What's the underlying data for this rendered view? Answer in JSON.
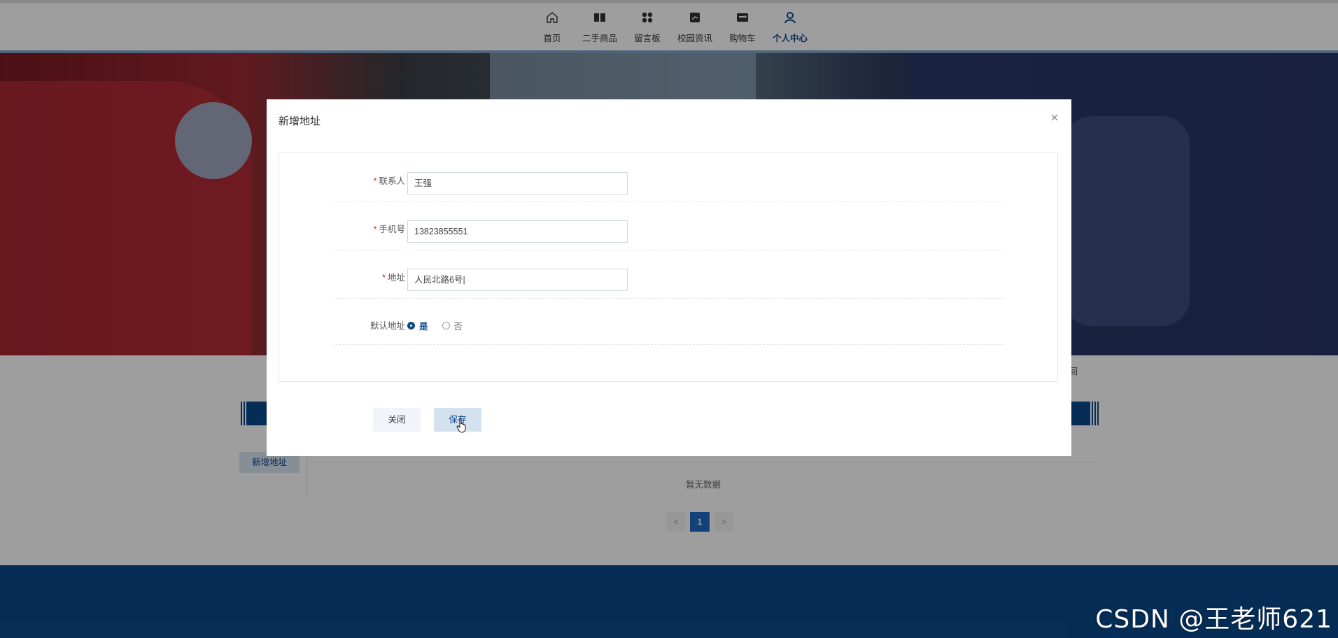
{
  "nav": {
    "items": [
      {
        "label": "首页",
        "icon": "home-icon"
      },
      {
        "label": "二手商品",
        "icon": "book-icon"
      },
      {
        "label": "留言板",
        "icon": "grid-icon"
      },
      {
        "label": "校园资讯",
        "icon": "news-icon"
      },
      {
        "label": "购物车",
        "icon": "cart-icon"
      },
      {
        "label": "个人中心",
        "icon": "user-icon",
        "active": true
      }
    ]
  },
  "page": {
    "return_text": "回",
    "add_address_label": "新增地址",
    "empty_text": "暂无数据",
    "pager": {
      "prev": "<",
      "current": "1",
      "next": ">"
    }
  },
  "modal": {
    "title": "新增地址",
    "fields": {
      "contact": {
        "label": "联系人",
        "required": "*",
        "value": "王强"
      },
      "phone": {
        "label": "手机号",
        "required": "*",
        "value": "13823855551"
      },
      "address": {
        "label": "地址",
        "required": "*",
        "value": "人民北路6号|"
      },
      "default": {
        "label": "默认地址",
        "options": [
          "是",
          "否"
        ],
        "selected": "是"
      }
    },
    "buttons": {
      "close": "关闭",
      "save": "保存"
    }
  },
  "watermark": "CSDN @王老师621",
  "colors": {
    "primary": "#0b4a8b",
    "accent": "#1e6bc0",
    "required": "#e02020"
  }
}
